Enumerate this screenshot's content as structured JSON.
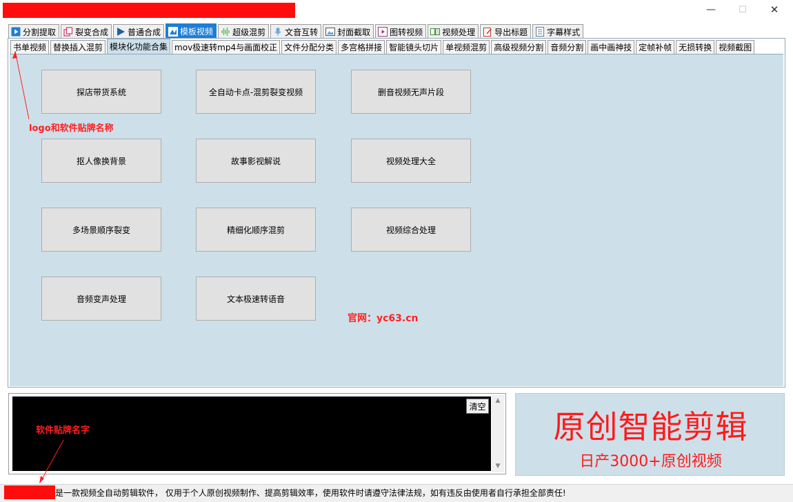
{
  "window": {
    "minimize_glyph": "—",
    "maximize_glyph": "☐",
    "close_glyph": "✕"
  },
  "main_tabs": [
    {
      "label": "分割提取",
      "icon": "play-icon"
    },
    {
      "label": "裂变合成",
      "icon": "copy-icon"
    },
    {
      "label": "普通合成",
      "icon": "play-icon"
    },
    {
      "label": "模板视频",
      "icon": "template-icon"
    },
    {
      "label": "超级混剪",
      "icon": "waveform-icon"
    },
    {
      "label": "文音互转",
      "icon": "microphone-icon"
    },
    {
      "label": "封面截取",
      "icon": "image-icon"
    },
    {
      "label": "图转视频",
      "icon": "video-icon"
    },
    {
      "label": "视频处理",
      "icon": "edit-icon"
    },
    {
      "label": "导出标题",
      "icon": "export-icon"
    },
    {
      "label": "字幕样式",
      "icon": "subtitle-icon"
    }
  ],
  "sub_tabs": [
    "书单视频",
    "替换插入混剪",
    "模块化功能合集",
    "mov极速转mp4与画面校正",
    "文件分配分类",
    "多宫格拼接",
    "智能镜头切片",
    "单视频混剪",
    "高级视频分割",
    "音频分割",
    "画中画神技",
    "定帧补帧",
    "无损转换",
    "视频截图"
  ],
  "functions": [
    "探店带货系统",
    "全自动卡点-混剪裂变视频",
    "删音视频无声片段",
    "抠人像换背景",
    "故事影视解说",
    "视频处理大全",
    "多场景顺序裂变",
    "精细化顺序混剪",
    "视频综合处理",
    "音频变声处理",
    "文本极速转语音"
  ],
  "site_text": "官网：yc63.cn",
  "annotations": {
    "logo": "logo和软件贴牌名称",
    "name": "软件贴牌名字"
  },
  "log": {
    "clear_label": "清空"
  },
  "promo": {
    "title": "原创智能剪辑",
    "subtitle": "日产3000+原创视频"
  },
  "status": {
    "text": "是一款视频全自动剪辑软件， 仅用于个人原创视频制作、提高剪辑效率，使用软件时请遵守法律法规，如有违反由使用者自行承担全部责任!"
  },
  "colors": {
    "panel": "#cde0ea",
    "active_tab": "#1c7ed6",
    "annotation_red": "#ff2020"
  }
}
